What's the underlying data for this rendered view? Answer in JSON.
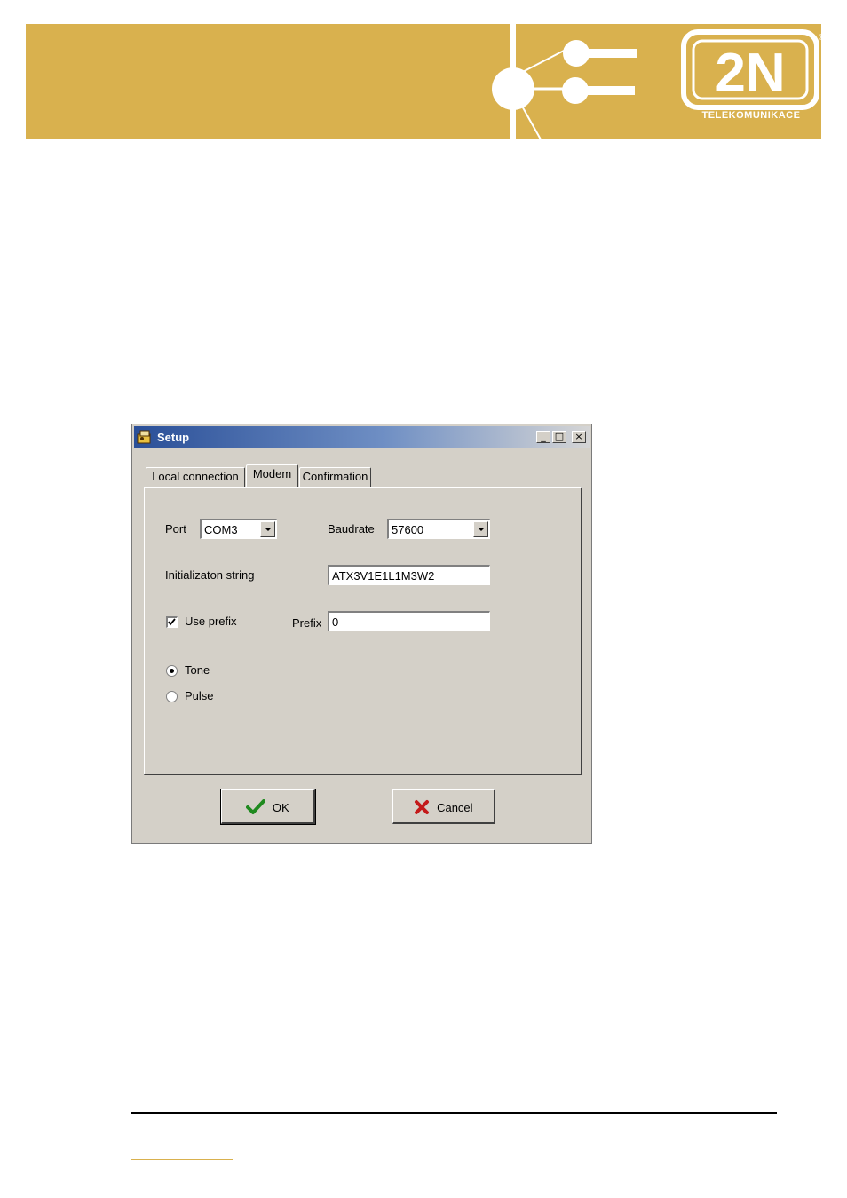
{
  "header": {
    "logo_text": "2N",
    "logo_subtitle": "TELEKOMUNIKACE",
    "brand_color": "#d9b14e",
    "registered_mark": "®"
  },
  "dialog": {
    "title": "Setup",
    "title_icon": "setup-app-icon",
    "window_buttons": {
      "minimize": "_",
      "maximize": "□",
      "close": "×"
    },
    "tabs": [
      {
        "label": "Local connection",
        "active": false
      },
      {
        "label": "Modem",
        "active": true
      },
      {
        "label": "Confirmation",
        "active": false
      }
    ],
    "port": {
      "label": "Port",
      "value": "COM3"
    },
    "baudrate": {
      "label": "Baudrate",
      "value": "57600"
    },
    "init_string": {
      "label": "Initializaton string",
      "value": "ATX3V1E1L1M3W2"
    },
    "use_prefix": {
      "label": "Use prefix",
      "checked": true
    },
    "prefix": {
      "label": "Prefix",
      "value": "0"
    },
    "dial_mode": [
      {
        "label": "Tone",
        "selected": true
      },
      {
        "label": "Pulse",
        "selected": false
      }
    ],
    "ok_button": {
      "label": "OK",
      "icon": "checkmark-icon"
    },
    "cancel_button": {
      "label": "Cancel",
      "icon": "cross-icon"
    }
  }
}
